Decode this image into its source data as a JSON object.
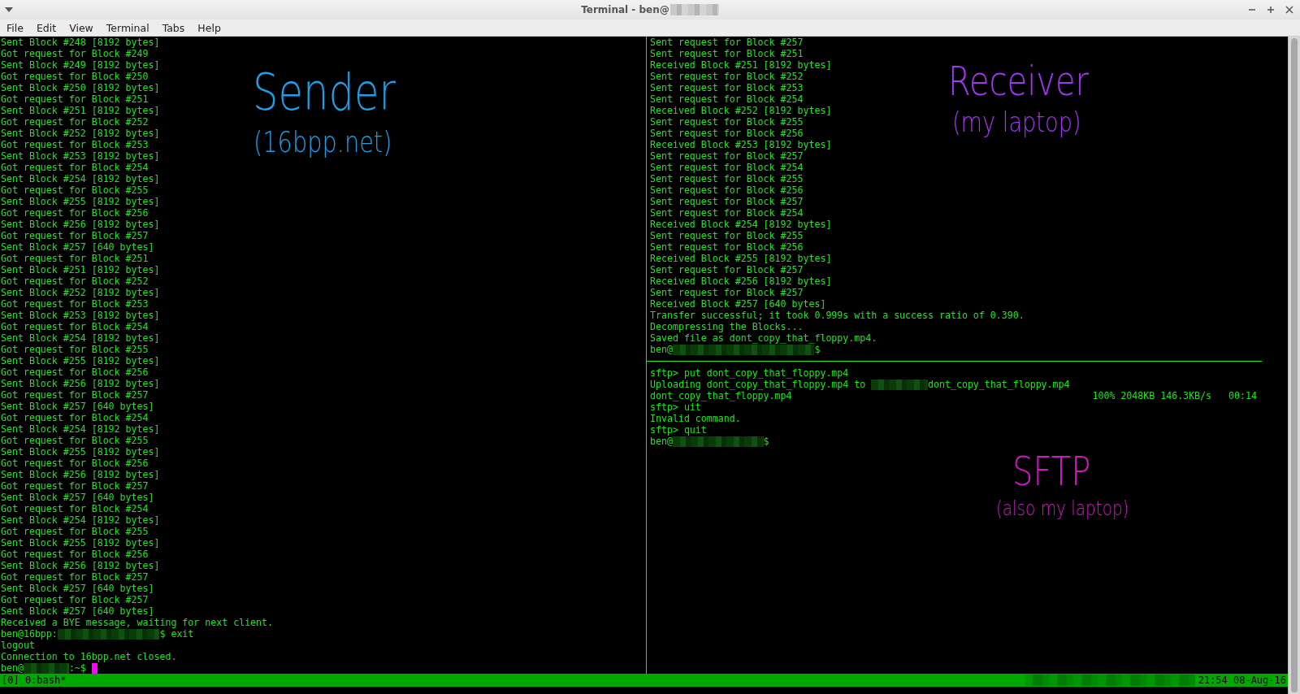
{
  "window": {
    "title": "Terminal - ben@",
    "title_redacted": true
  },
  "menu": [
    "File",
    "Edit",
    "View",
    "Terminal",
    "Tabs",
    "Help"
  ],
  "left_pane": {
    "cursor": true,
    "lines": [
      "Sent Block #248 [8192 bytes]",
      "Got request for Block #249",
      "Sent Block #249 [8192 bytes]",
      "Got request for Block #250",
      "Sent Block #250 [8192 bytes]",
      "Got request for Block #251",
      "Sent Block #251 [8192 bytes]",
      "Got request for Block #252",
      "Sent Block #252 [8192 bytes]",
      "Got request for Block #253",
      "Sent Block #253 [8192 bytes]",
      "Got request for Block #254",
      "Sent Block #254 [8192 bytes]",
      "Got request for Block #255",
      "Sent Block #255 [8192 bytes]",
      "Got request for Block #256",
      "Sent Block #256 [8192 bytes]",
      "Got request for Block #257",
      "Sent Block #257 [640 bytes]",
      "Got request for Block #251",
      "Sent Block #251 [8192 bytes]",
      "Got request for Block #252",
      "Sent Block #252 [8192 bytes]",
      "Got request for Block #253",
      "Sent Block #253 [8192 bytes]",
      "Got request for Block #254",
      "Sent Block #254 [8192 bytes]",
      "Got request for Block #255",
      "Sent Block #255 [8192 bytes]",
      "Got request for Block #256",
      "Sent Block #256 [8192 bytes]",
      "Got request for Block #257",
      "Sent Block #257 [640 bytes]",
      "Got request for Block #254",
      "Sent Block #254 [8192 bytes]",
      "Got request for Block #255",
      "Sent Block #255 [8192 bytes]",
      "Got request for Block #256",
      "Sent Block #256 [8192 bytes]",
      "Got request for Block #257",
      "Sent Block #257 [640 bytes]",
      "Got request for Block #254",
      "Sent Block #254 [8192 bytes]",
      "Got request for Block #255",
      "Sent Block #255 [8192 bytes]",
      "Got request for Block #256",
      "Sent Block #256 [8192 bytes]",
      "Got request for Block #257",
      "Sent Block #257 [640 bytes]",
      "Got request for Block #257",
      "Sent Block #257 [640 bytes]",
      "Received a BYE message, waiting for next client.",
      {
        "kind": "redacted",
        "text": "ben@16bpp:",
        "after": "$ exit"
      },
      "logout",
      "Connection to 16bpp.net closed.",
      {
        "kind": "redacted",
        "text": "ben@",
        "after": ":~$"
      }
    ]
  },
  "receiver_pane": {
    "cursor": false,
    "lines": [
      "Sent request for Block #257",
      "Sent request for Block #251",
      "Received Block #251 [8192 bytes]",
      "Sent request for Block #252",
      "Sent request for Block #253",
      "Sent request for Block #254",
      "Received Block #252 [8192 bytes]",
      "Sent request for Block #255",
      "Sent request for Block #256",
      "Received Block #253 [8192 bytes]",
      "Sent request for Block #257",
      "Sent request for Block #254",
      "Sent request for Block #255",
      "Sent request for Block #256",
      "Sent request for Block #257",
      "Sent request for Block #254",
      "Received Block #254 [8192 bytes]",
      "Sent request for Block #255",
      "Sent request for Block #256",
      "Received Block #255 [8192 bytes]",
      "Sent request for Block #257",
      "Received Block #256 [8192 bytes]",
      "Sent request for Block #257",
      "Received Block #257 [640 bytes]",
      "Transfer successful; it took 0.999s with a success ratio of 0.390.",
      "Decompressing the Blocks...",
      "Saved file as dont_copy_that_floppy.mp4.",
      {
        "kind": "redacted",
        "text": "ben@",
        "after": "$"
      }
    ]
  },
  "sftp_pane": {
    "cursor": false,
    "lines": [
      "sftp> put dont_copy_that_floppy.mp4",
      {
        "kind": "redacted",
        "text": "Uploading dont_copy_that_floppy.mp4 to",
        "after": "dont_copy_that_floppy.mp4"
      },
      {
        "kind": "progress",
        "text": "dont_copy_that_floppy.mp4",
        "after": "100% 2048KB 146.3KB/s   00:14"
      },
      "sftp> uit",
      "Invalid command.",
      "sftp> quit",
      {
        "kind": "redacted",
        "text": "ben@",
        "after": "$"
      }
    ]
  },
  "annotations": [
    {
      "text": "Sender",
      "color": "#1e9ee8"
    },
    {
      "text": "(16bpp.net)",
      "color": "#1e9ee8"
    },
    {
      "text": "Receiver",
      "color": "#a335f5"
    },
    {
      "text": "(my laptop)",
      "color": "#a335f5"
    },
    {
      "text": "SFTP",
      "color": "#d216c4"
    },
    {
      "text": "(also my laptop)",
      "color": "#d216c4"
    }
  ],
  "status_bar": {
    "left": "[0] 0:bash*",
    "right": "21:54 08-Aug-16",
    "right_redacted": true
  }
}
